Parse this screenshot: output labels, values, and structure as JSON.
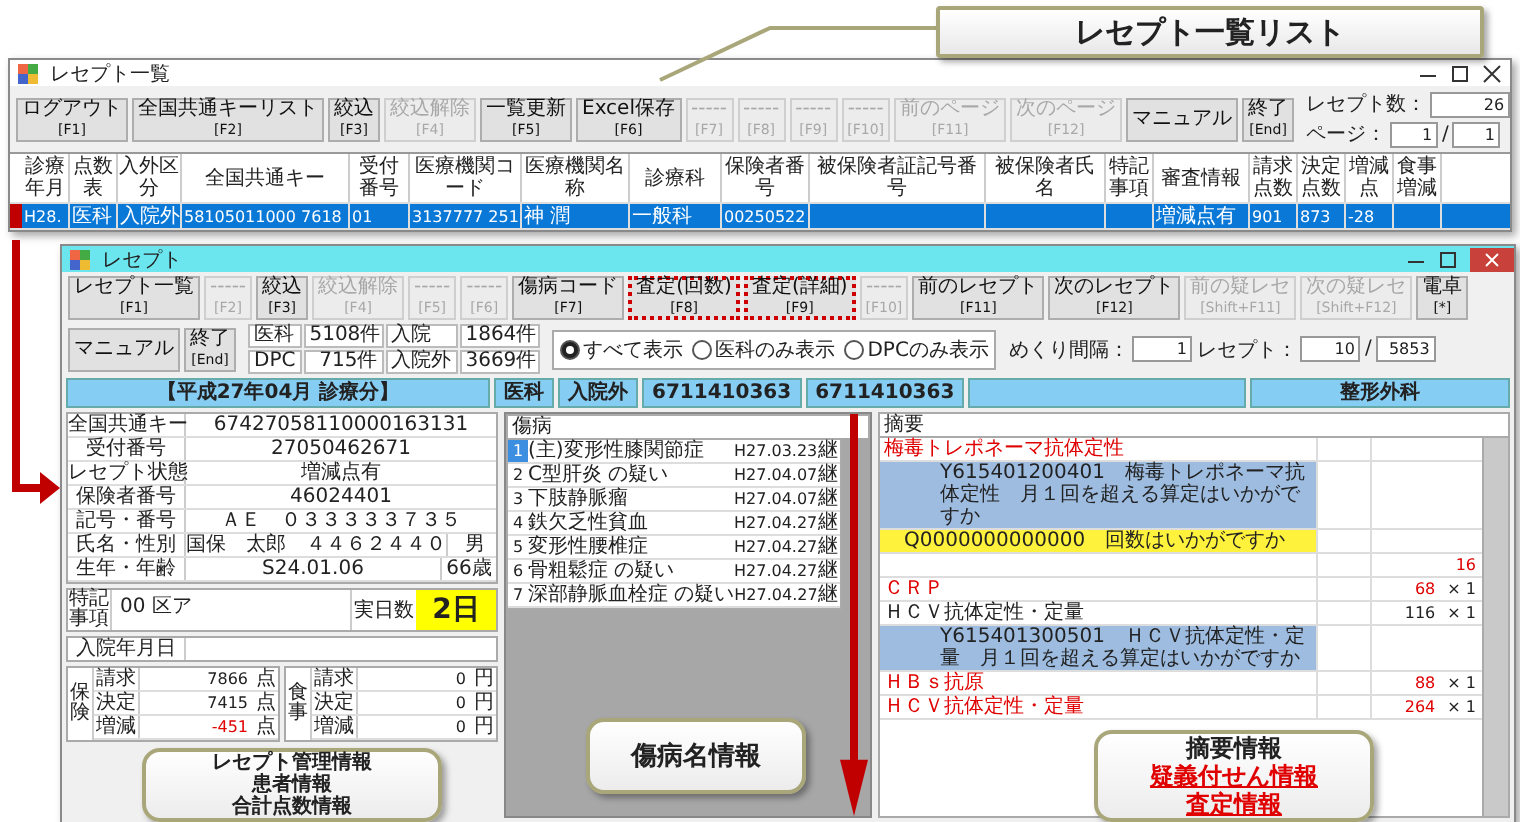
{
  "list_callout": "レセプト一覧リスト",
  "list_window": {
    "title": "レセプト一覧",
    "toolbar": [
      {
        "label": "ログアウト",
        "key": "[F1]",
        "disabled": false
      },
      {
        "label": "全国共通キーリスト",
        "key": "[F2]",
        "disabled": false
      },
      {
        "label": "絞込",
        "key": "[F3]",
        "disabled": false
      },
      {
        "label": "絞込解除",
        "key": "[F4]",
        "disabled": true
      },
      {
        "label": "一覧更新",
        "key": "[F5]",
        "disabled": false
      },
      {
        "label": "Excel保存",
        "key": "[F6]",
        "disabled": false
      },
      {
        "label": "-----",
        "key": "[F7]",
        "disabled": true
      },
      {
        "label": "-----",
        "key": "[F8]",
        "disabled": true
      },
      {
        "label": "-----",
        "key": "[F9]",
        "disabled": true
      },
      {
        "label": "-----",
        "key": "[F10]",
        "disabled": true
      },
      {
        "label": "前のページ",
        "key": "[F11]",
        "disabled": true
      },
      {
        "label": "次のページ",
        "key": "[F12]",
        "disabled": true
      },
      {
        "label": "マニュアル",
        "disabled": false
      },
      {
        "label": "終了",
        "key": "[End]",
        "disabled": false
      }
    ],
    "count_label": "レセプト数：",
    "count": "26",
    "page_label": "ページ：",
    "page": "1",
    "page_sep": "/",
    "pages": "1",
    "columns": [
      "診療年月",
      "点数表",
      "入外区分",
      "全国共通キー",
      "受付番号",
      "医療機関コード",
      "医療機関名称",
      "診療科",
      "保険者番号",
      "被保険者証記号番号",
      "被保険者氏名",
      "特記事項",
      "審査情報",
      "請求点数",
      "決定点数",
      "増減点",
      "食事増減"
    ],
    "rows": [
      {
        "selected": true,
        "flagged": true,
        "cells": [
          "H28.",
          "医科",
          "入院外",
          "58105011000 7618",
          "01",
          "3137777 251",
          "神 潤",
          "一般科",
          "00250522",
          "",
          "",
          "",
          "増減点有",
          "901",
          "873",
          "-28",
          ""
        ]
      }
    ]
  },
  "receipt_window": {
    "title": "レセプト",
    "toolbar": [
      {
        "label": "レセプト一覧",
        "key": "[F1]",
        "disabled": false,
        "highlighted": false
      },
      {
        "label": "-----",
        "key": "[F2]",
        "disabled": true,
        "highlighted": false
      },
      {
        "label": "絞込",
        "key": "[F3]",
        "disabled": false,
        "highlighted": false
      },
      {
        "label": "絞込解除",
        "key": "[F4]",
        "disabled": true,
        "highlighted": false
      },
      {
        "label": "-----",
        "key": "[F5]",
        "disabled": true,
        "highlighted": false
      },
      {
        "label": "-----",
        "key": "[F6]",
        "disabled": true,
        "highlighted": false
      },
      {
        "label": "傷病コード",
        "key": "[F7]",
        "disabled": false,
        "highlighted": false
      },
      {
        "label": "査定(回数)",
        "key": "[F8]",
        "disabled": false,
        "highlighted": true
      },
      {
        "label": "査定(詳細)",
        "key": "[F9]",
        "disabled": false,
        "highlighted": true
      },
      {
        "label": "-----",
        "key": "[F10]",
        "disabled": true,
        "highlighted": false
      },
      {
        "label": "前のレセプト",
        "key": "[F11]",
        "disabled": false,
        "highlighted": false
      },
      {
        "label": "次のレセプト",
        "key": "[F12]",
        "disabled": false,
        "highlighted": false
      },
      {
        "label": "前の疑レセ",
        "key": "[Shift+F11]",
        "disabled": true,
        "highlighted": false
      },
      {
        "label": "次の疑レセ",
        "key": "[Shift+F12]",
        "disabled": true,
        "highlighted": false
      },
      {
        "label": "電卓",
        "key": "[*]",
        "disabled": false,
        "highlighted": false
      },
      {
        "label": "マニュアル",
        "disabled": false,
        "highlighted": false
      },
      {
        "label": "終了",
        "key": "[End]",
        "disabled": false,
        "highlighted": false
      }
    ],
    "counts": [
      {
        "label": "医科",
        "value": "5108件"
      },
      {
        "label": "入院",
        "value": "1864件"
      },
      {
        "label": "DPC",
        "value": "715件"
      },
      {
        "label": "入院外",
        "value": "3669件"
      }
    ],
    "filters": [
      {
        "label": "すべて表示",
        "selected": true
      },
      {
        "label": "医科のみ表示",
        "selected": false
      },
      {
        "label": "DPCのみ表示",
        "selected": false
      }
    ],
    "interval_label": "めくり間隔：",
    "interval": "1",
    "receipt_label": "レセプト：",
    "receipt": "10",
    "receipt_sep": "/",
    "receipt_total": "5853",
    "period": "【平成27年04月 診療分】",
    "summary": [
      "医科",
      "入院外",
      "6711410363",
      "6711410363"
    ],
    "department": "整形外科",
    "fields": [
      {
        "label": "全国共通キー",
        "value": "67427058110000163131"
      },
      {
        "label": "受付番号",
        "value": "27050462671"
      },
      {
        "label": "レセプト状態",
        "value": "増減点有"
      },
      {
        "label": "保険者番号",
        "value": "46024401"
      },
      {
        "label": "記号・番号",
        "value": "ＡＥ　０３３３３３７３５"
      },
      {
        "label": "氏名・性別",
        "value": "国保　太郎　４４６２４４０",
        "extra": "男"
      },
      {
        "label": "生年・年齢",
        "value": "S24.01.06",
        "extra": "66歳"
      }
    ],
    "remarks_label": "特記事項",
    "remarks": "00 区ア",
    "days_label": "実日数",
    "days": "2日",
    "admission_label": "入院年月日",
    "totals": [
      {
        "group": "保険",
        "rows": [
          {
            "label": "請求",
            "value": "7866",
            "unit": "点",
            "alert": false
          },
          {
            "label": "決定",
            "value": "7415",
            "unit": "点",
            "alert": false
          },
          {
            "label": "増減",
            "value": "-451",
            "unit": "点",
            "alert": true
          }
        ]
      },
      {
        "group": "食事",
        "rows": [
          {
            "label": "請求",
            "value": "0",
            "unit": "円",
            "alert": false
          },
          {
            "label": "決定",
            "value": "0",
            "unit": "円",
            "alert": false
          },
          {
            "label": "増減",
            "value": "0",
            "unit": "円",
            "alert": false
          }
        ]
      }
    ],
    "diseases_label": "傷病",
    "diseases": [
      {
        "no": "1",
        "name": "(主)変形性膝関節症",
        "date": "H27.03.23",
        "outcome": "継",
        "selected": true
      },
      {
        "no": "2",
        "name": "C型肝炎 の疑い",
        "date": "H27.04.07",
        "outcome": "継",
        "selected": false
      },
      {
        "no": "3",
        "name": "下肢静脈瘤",
        "date": "H27.04.07",
        "outcome": "継",
        "selected": false
      },
      {
        "no": "4",
        "name": "鉄欠乏性貧血",
        "date": "H27.04.27",
        "outcome": "継",
        "selected": false
      },
      {
        "no": "5",
        "name": "変形性腰椎症",
        "date": "H27.04.27",
        "outcome": "継",
        "selected": false
      },
      {
        "no": "6",
        "name": "骨粗鬆症 の疑い",
        "date": "H27.04.27",
        "outcome": "継",
        "selected": false
      },
      {
        "no": "7",
        "name": "深部静脈血栓症 の疑い",
        "date": "H27.04.27",
        "outcome": "継",
        "selected": false
      }
    ],
    "entries_label": "摘要",
    "entries": [
      {
        "kind": "item",
        "text": "梅毒トレポネーマ抗体定性",
        "alert": true
      },
      {
        "kind": "note",
        "text": "Y615401200401　梅毒トレポネーマ抗体定性　月１回を超える算定はいかがですか",
        "alert": false
      },
      {
        "kind": "query",
        "text": "Q0000000000000　回数はいかがですか",
        "alert": false
      },
      {
        "kind": "item",
        "points": "16",
        "alert": true
      },
      {
        "kind": "item",
        "text": "ＣＲＰ",
        "points": "68",
        "times": "× 1",
        "alert": true
      },
      {
        "kind": "item",
        "text": "ＨＣＶ抗体定性・定量",
        "points": "116",
        "times": "× 1",
        "alert": false
      },
      {
        "kind": "note",
        "text": "Y615401300501　ＨＣＶ抗体定性・定量　月１回を超える算定はいかがですか",
        "alert": false
      },
      {
        "kind": "item",
        "text": "ＨＢｓ抗原",
        "points": "88",
        "times": "× 1",
        "alert": true
      },
      {
        "kind": "item",
        "text": "ＨＣＶ抗体定性・定量",
        "points": "264",
        "times": "× 1",
        "alert": true
      }
    ]
  },
  "info_callouts": [
    {
      "lines": [
        {
          "text": "レセプト管理情報",
          "emphasis": false
        },
        {
          "text": "患者情報",
          "emphasis": false
        },
        {
          "text": "合計点数情報",
          "emphasis": false
        }
      ]
    },
    {
      "lines": [
        {
          "text": "傷病名情報",
          "emphasis": false
        }
      ]
    },
    {
      "lines": [
        {
          "text": "摘要情報",
          "emphasis": false
        },
        {
          "text": "疑義付せん情報",
          "emphasis": true
        },
        {
          "text": "査定情報",
          "emphasis": true
        }
      ]
    }
  ]
}
